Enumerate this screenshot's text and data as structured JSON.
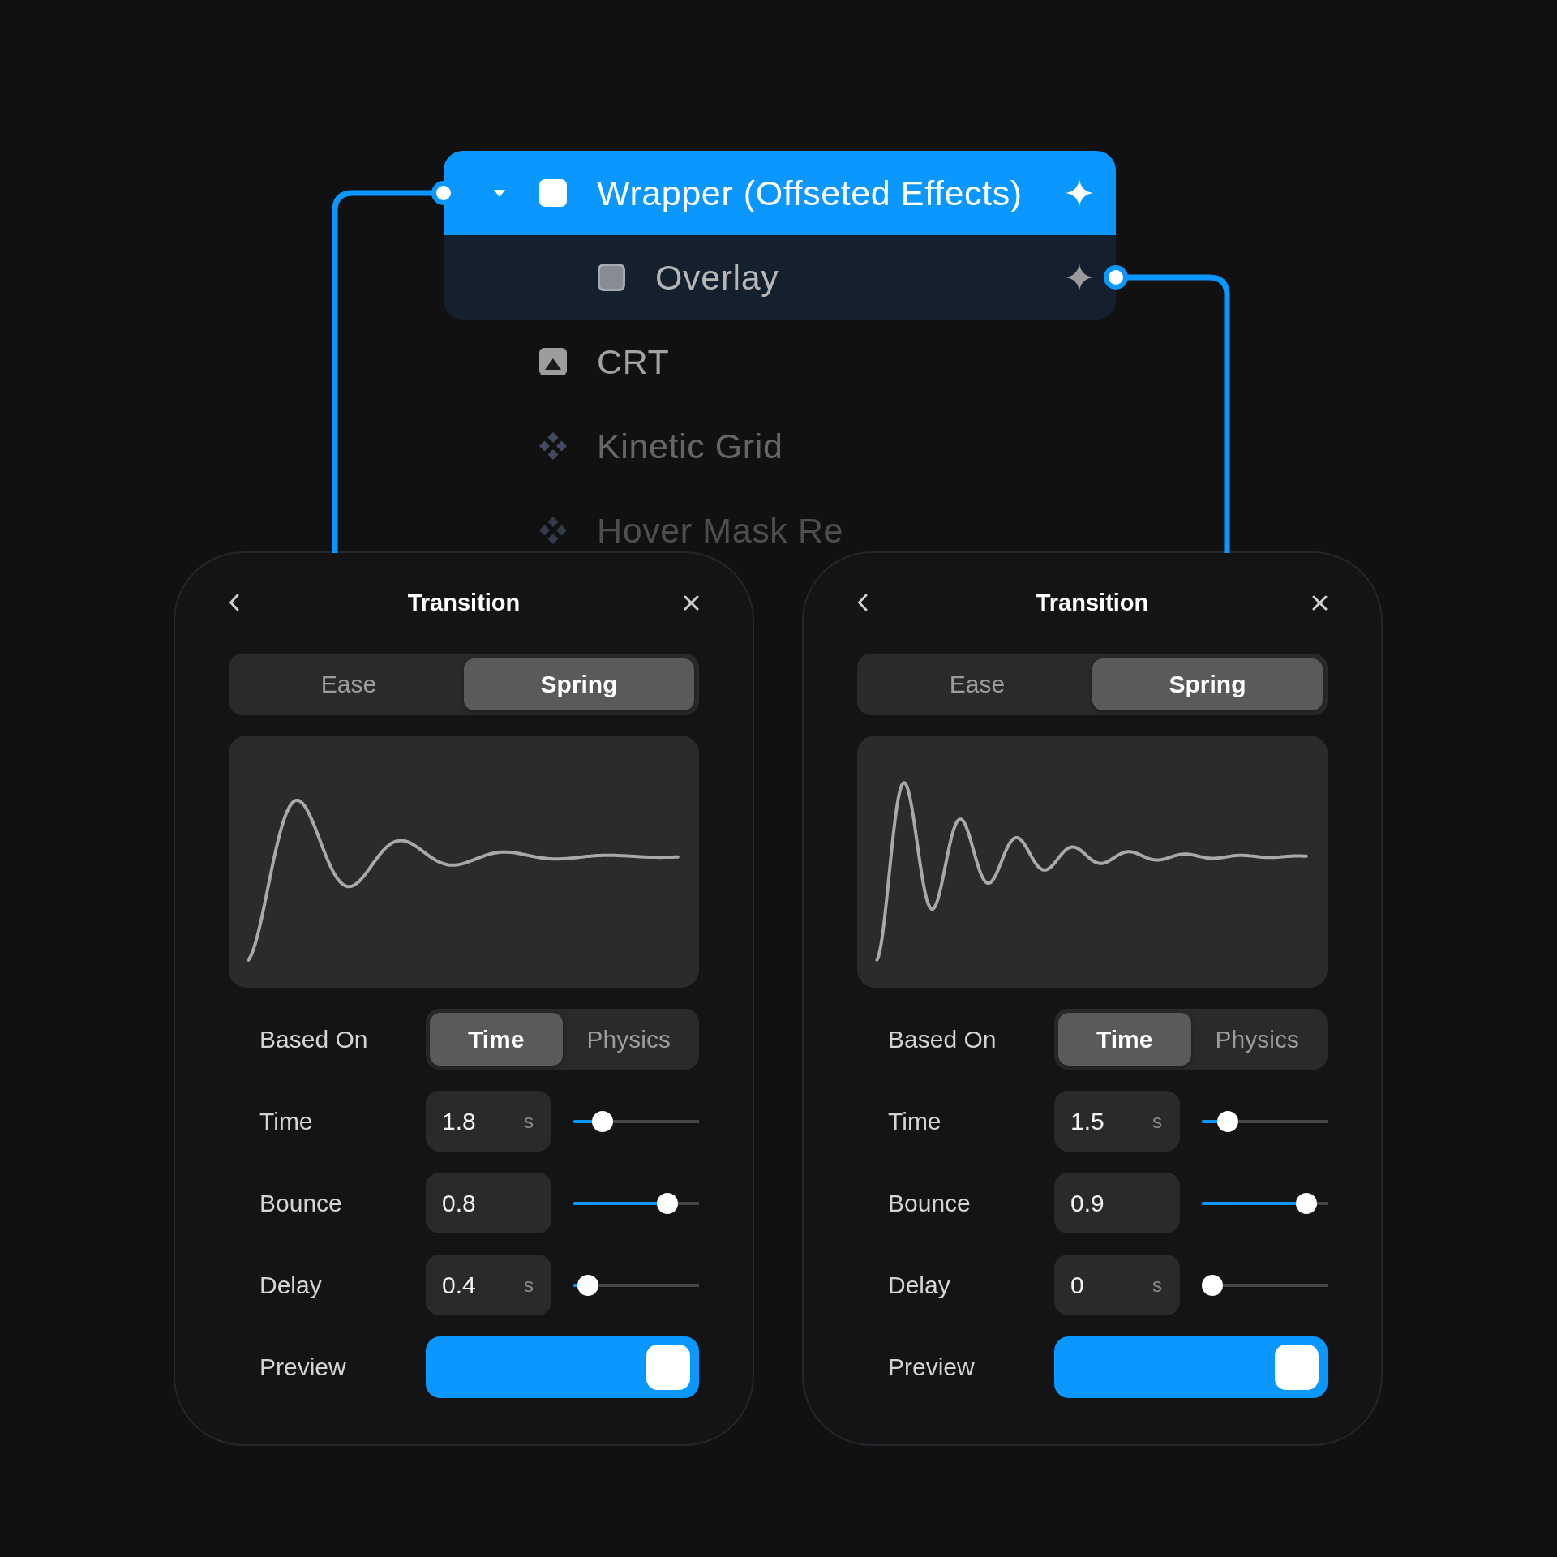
{
  "layers": {
    "items": [
      {
        "name": "Wrapper (Offseted Effects)",
        "kind": "frame",
        "selected": true,
        "expanded": true,
        "effect": true,
        "connected": true,
        "children": [
          {
            "name": "Overlay",
            "kind": "fill",
            "selected": false,
            "effect": true,
            "connected": true
          }
        ]
      },
      {
        "name": "CRT",
        "kind": "image",
        "selected": false,
        "effect": false,
        "connected": false
      },
      {
        "name": "Kinetic Grid",
        "kind": "component",
        "selected": false,
        "effect": false,
        "connected": false
      },
      {
        "name": "Hover Mask Re",
        "kind": "component",
        "selected": false,
        "effect": false,
        "connected": false
      }
    ]
  },
  "panels": [
    {
      "title": "Transition",
      "tabs": [
        {
          "label": "Ease",
          "selected": false
        },
        {
          "label": "Spring",
          "selected": true
        }
      ],
      "fields": [
        {
          "kind": "segmented",
          "label": "Based On",
          "options": [
            {
              "label": "Time",
              "selected": true
            },
            {
              "label": "Physics",
              "selected": false
            }
          ]
        },
        {
          "kind": "slider",
          "label": "Time",
          "value": "1.8",
          "unit": "s",
          "level": 0.18
        },
        {
          "kind": "slider",
          "label": "Bounce",
          "value": "0.8",
          "level": 0.8
        },
        {
          "kind": "slider",
          "label": "Delay",
          "value": "0.4",
          "unit": "s",
          "level": 0.04
        },
        {
          "kind": "toggle",
          "label": "Preview",
          "on": true
        }
      ]
    },
    {
      "title": "Transition",
      "tabs": [
        {
          "label": "Ease",
          "selected": false
        },
        {
          "label": "Spring",
          "selected": true
        }
      ],
      "fields": [
        {
          "kind": "segmented",
          "label": "Based On",
          "options": [
            {
              "label": "Time",
              "selected": true
            },
            {
              "label": "Physics",
              "selected": false
            }
          ]
        },
        {
          "kind": "slider",
          "label": "Time",
          "value": "1.5",
          "unit": "s",
          "level": 0.15
        },
        {
          "kind": "slider",
          "label": "Bounce",
          "value": "0.9",
          "level": 0.9
        },
        {
          "kind": "slider",
          "label": "Delay",
          "value": "0",
          "unit": "s",
          "level": 0
        },
        {
          "kind": "toggle",
          "label": "Preview",
          "on": true
        }
      ]
    }
  ]
}
